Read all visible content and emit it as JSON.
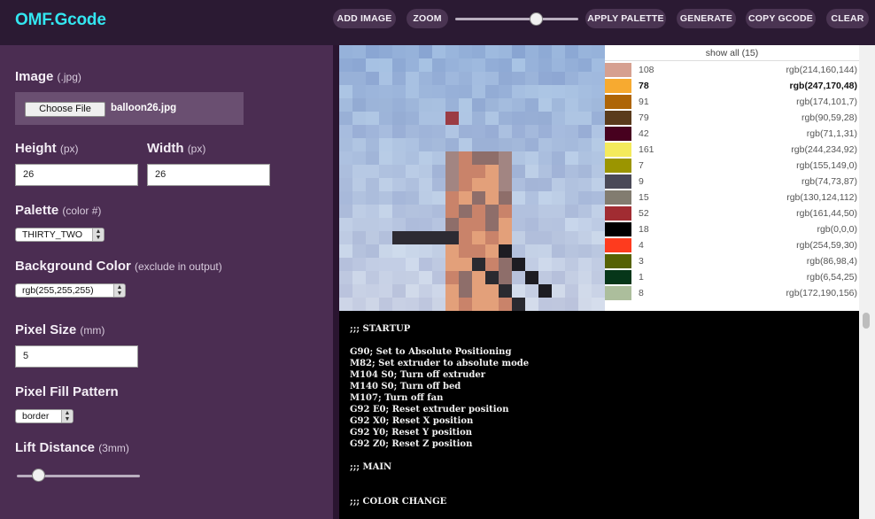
{
  "app": {
    "title": "OMF.Gcode"
  },
  "toolbar": {
    "add_image": "ADD IMAGE",
    "zoom": "ZOOM",
    "apply_palette": "APPLY PALETTE",
    "generate": "GENERATE",
    "copy_gcode": "COPY GCODE",
    "clear": "CLEAR",
    "zoom_level": 0.66
  },
  "sidebar": {
    "image_label": "Image",
    "image_hint": "(.jpg)",
    "choose_file": "Choose File",
    "file_name": "balloon26.jpg",
    "height_label": "Height",
    "height_hint": "(px)",
    "height_value": "26",
    "width_label": "Width",
    "width_hint": "(px)",
    "width_value": "26",
    "palette_label": "Palette",
    "palette_hint": "(color #)",
    "palette_value": "THIRTY_TWO",
    "bg_label": "Background Color",
    "bg_hint": "(exclude in output)",
    "bg_value": "rgb(255,255,255)",
    "pixel_size_label": "Pixel Size",
    "pixel_size_hint": "(mm)",
    "pixel_size_value": "5",
    "fill_label": "Pixel Fill Pattern",
    "fill_value": "border",
    "lift_label": "Lift Distance",
    "lift_hint": "(3mm)",
    "lift_level": 0.18
  },
  "palette_table": {
    "show_all": "show all (15)",
    "rows": [
      {
        "count": "108",
        "rgb": "rgb(214,160,144)",
        "color": "#d6a090",
        "selected": false
      },
      {
        "count": "78",
        "rgb": "rgb(247,170,48)",
        "color": "#f7aa30",
        "selected": true
      },
      {
        "count": "91",
        "rgb": "rgb(174,101,7)",
        "color": "#ae6507",
        "selected": false
      },
      {
        "count": "79",
        "rgb": "rgb(90,59,28)",
        "color": "#5a3b1c",
        "selected": false
      },
      {
        "count": "42",
        "rgb": "rgb(71,1,31)",
        "color": "#47011f",
        "selected": false
      },
      {
        "count": "161",
        "rgb": "rgb(244,234,92)",
        "color": "#f4ea5c",
        "selected": false
      },
      {
        "count": "7",
        "rgb": "rgb(155,149,0)",
        "color": "#9b9500",
        "selected": false
      },
      {
        "count": "9",
        "rgb": "rgb(74,73,87)",
        "color": "#4a4957",
        "selected": false
      },
      {
        "count": "15",
        "rgb": "rgb(130,124,112)",
        "color": "#827c70",
        "selected": false
      },
      {
        "count": "52",
        "rgb": "rgb(161,44,50)",
        "color": "#a12c32",
        "selected": false
      },
      {
        "count": "18",
        "rgb": "rgb(0,0,0)",
        "color": "#000000",
        "selected": false
      },
      {
        "count": "4",
        "rgb": "rgb(254,59,30)",
        "color": "#fe3b1e",
        "selected": false
      },
      {
        "count": "3",
        "rgb": "rgb(86,98,4)",
        "color": "#566204",
        "selected": false
      },
      {
        "count": "1",
        "rgb": "rgb(6,54,25)",
        "color": "#063619",
        "selected": false
      },
      {
        "count": "8",
        "rgb": "rgb(172,190,156)",
        "color": "#acbe9c",
        "selected": false
      }
    ]
  },
  "gcode": {
    "lines": [
      ";;; STARTUP",
      "",
      "G90; Set to Absolute Positioning",
      "M82; Set extruder to absolute mode",
      "M104 S0; Turn off extruder",
      "M140 S0; Turn off bed",
      "M107; Turn off fan",
      "G92 E0; Reset extruder position",
      "G92 X0; Reset X position",
      "G92 Y0; Reset Y position",
      "G92 Z0; Reset Z position",
      "",
      ";;; MAIN",
      "",
      "",
      ";;; COLOR CHANGE"
    ]
  }
}
